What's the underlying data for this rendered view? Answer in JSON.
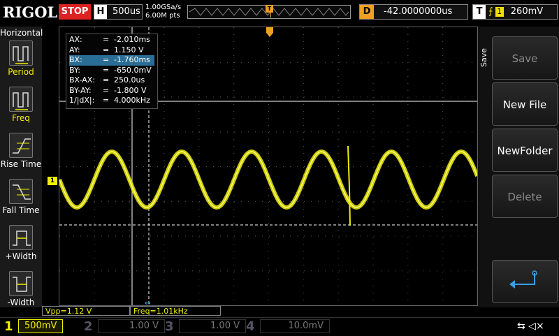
{
  "topbar": {
    "logo": "RIGOL",
    "run_state": "STOP",
    "horizontal_label": "H",
    "timebase": "500us",
    "sample_rate": "1.00GSa/s",
    "memory_depth": "6.00M pts",
    "trigger_marker": "T",
    "delay_label": "D",
    "delay_value": "-42.0000000us",
    "trigger_label": "T",
    "trigger_channel": "1",
    "trigger_level": "260mV"
  },
  "left_menu": {
    "title": "Horizontal",
    "items": [
      {
        "label": "Period"
      },
      {
        "label": "Freq"
      },
      {
        "label": "Rise Time"
      },
      {
        "label": "Fall Time"
      },
      {
        "label": "+Width"
      },
      {
        "label": "-Width"
      }
    ]
  },
  "cursor_readout": {
    "rows": [
      {
        "key": "AX:",
        "eq": "=",
        "value": "-2.010ms"
      },
      {
        "key": "AY:",
        "eq": "=",
        "value": "1.150 V"
      },
      {
        "key": "BX:",
        "eq": "=",
        "value": "-1.760ms"
      },
      {
        "key": "BY:",
        "eq": "=",
        "value": "-650.0mV"
      },
      {
        "key": "BX-AX:",
        "eq": "=",
        "value": "250.0us"
      },
      {
        "key": "BY-AY:",
        "eq": "=",
        "value": "-1.800 V"
      },
      {
        "key": "1/|dX|:",
        "eq": "=",
        "value": "4.000kHz"
      }
    ],
    "selected_row": "BX:"
  },
  "right_menu": {
    "title": "Save",
    "buttons": [
      {
        "label": "Save",
        "enabled": false
      },
      {
        "label": "New File",
        "enabled": true
      },
      {
        "label": "NewFolder",
        "enabled": true
      },
      {
        "label": "Delete",
        "enabled": false
      }
    ],
    "return_icon": "return-arrow-icon"
  },
  "measurements": {
    "vpp": "Vpp=1.12 V",
    "freq": "Freq=1.01kHz"
  },
  "channels": [
    {
      "num": "1",
      "scale": "500mV",
      "active": true,
      "color": "#f0f000"
    },
    {
      "num": "2",
      "scale": "1.00 V",
      "active": false,
      "color": "#00c8c8"
    },
    {
      "num": "3",
      "scale": "1.00 V",
      "active": false,
      "color": "#d040d0"
    },
    {
      "num": "4",
      "scale": "10.0mV",
      "active": false,
      "color": "#3060ff"
    }
  ],
  "colors": {
    "ch1": "#f0f000",
    "trigger": "#f0a020",
    "stop": "#dd2222",
    "highlight": "#2a6e96"
  }
}
